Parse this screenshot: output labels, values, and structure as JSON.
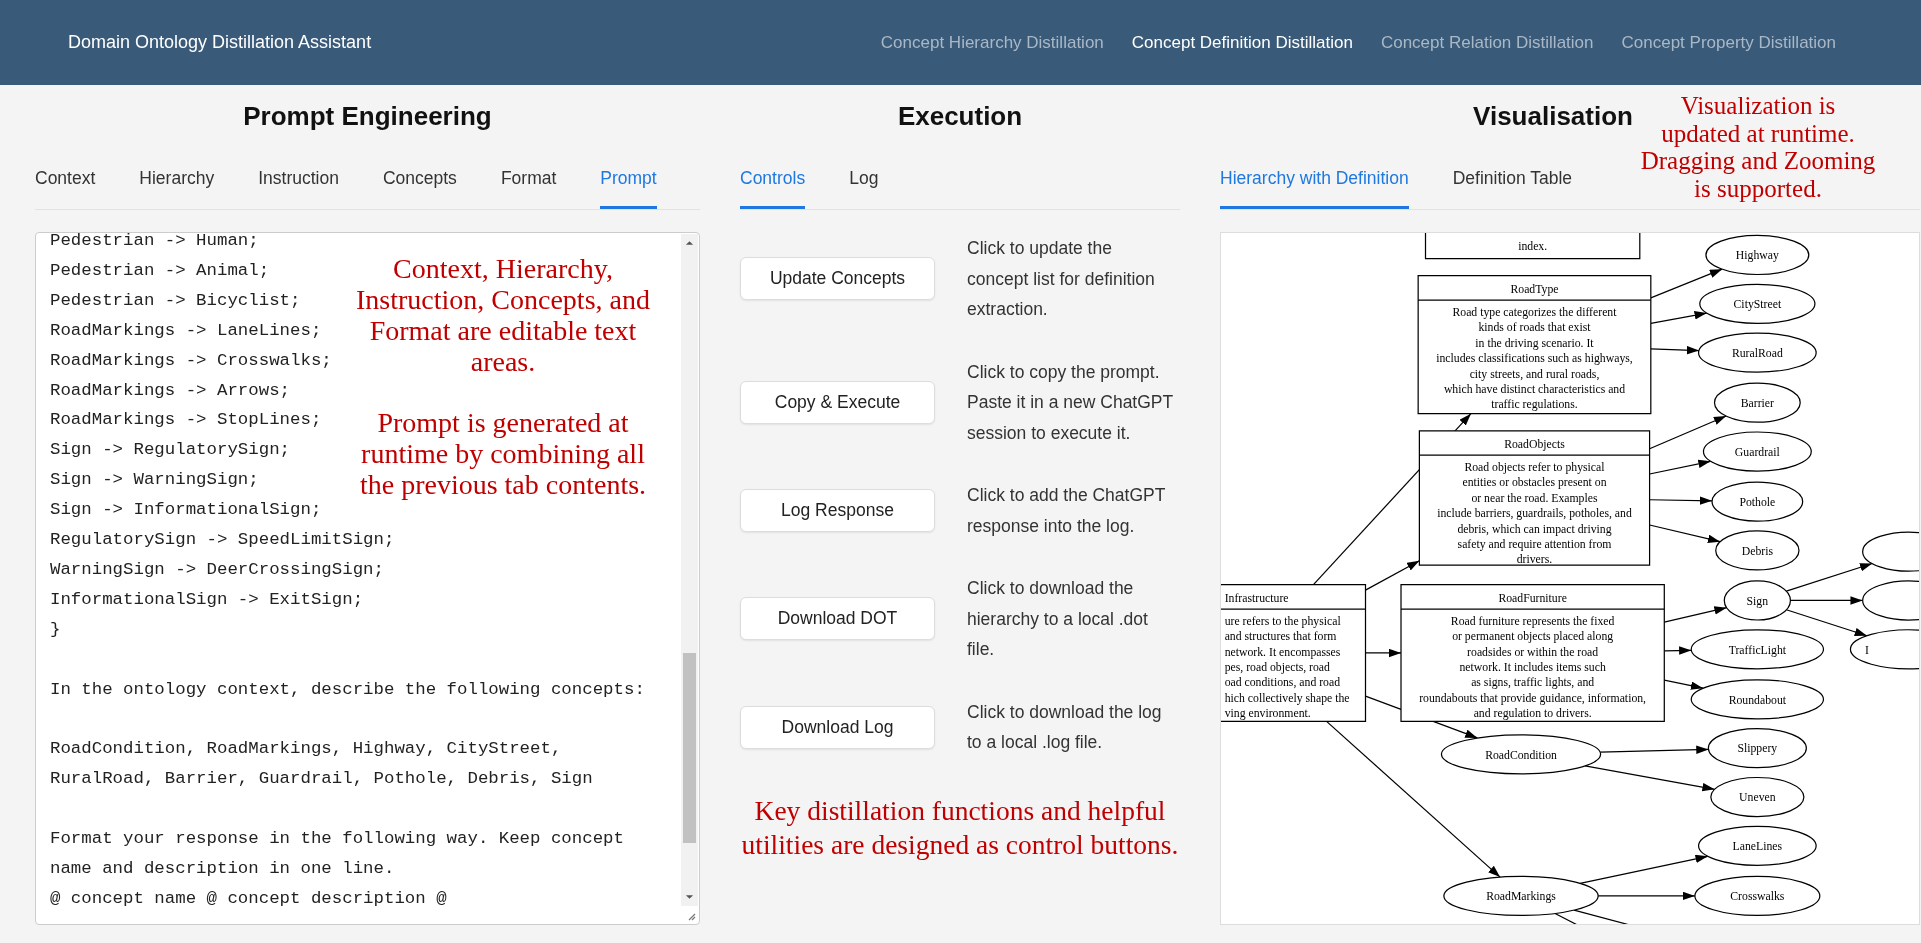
{
  "header": {
    "title": "Domain Ontology Distillation Assistant",
    "nav": [
      {
        "label": "Concept Hierarchy Distillation",
        "selected": false
      },
      {
        "label": "Concept Definition Distillation",
        "selected": true
      },
      {
        "label": "Concept Relation Distillation",
        "selected": false
      },
      {
        "label": "Concept Property Distillation",
        "selected": false
      }
    ]
  },
  "prompt_engineering": {
    "heading": "Prompt Engineering",
    "tabs": [
      {
        "label": "Context",
        "selected": false
      },
      {
        "label": "Hierarchy",
        "selected": false
      },
      {
        "label": "Instruction",
        "selected": false
      },
      {
        "label": "Concepts",
        "selected": false
      },
      {
        "label": "Format",
        "selected": false
      },
      {
        "label": "Prompt",
        "selected": true
      }
    ],
    "prompt_blocks": [
      [
        "Pedestrian -> Human;",
        "Pedestrian -> Animal;",
        "Pedestrian -> Bicyclist;",
        "RoadMarkings -> LaneLines;",
        "RoadMarkings -> Crosswalks;",
        "RoadMarkings -> Arrows;",
        "RoadMarkings -> StopLines;",
        "Sign -> RegulatorySign;",
        "Sign -> WarningSign;",
        "Sign -> InformationalSign;",
        "RegulatorySign -> SpeedLimitSign;",
        "WarningSign -> DeerCrossingSign;",
        "InformationalSign -> ExitSign;",
        "}"
      ],
      [
        "In the ontology context, describe the following concepts:"
      ],
      [
        "RoadCondition, RoadMarkings, Highway, CityStreet,",
        "RuralRoad, Barrier, Guardrail, Pothole, Debris, Sign"
      ],
      [
        "Format your response in the following way. Keep concept",
        "name and description in one line.",
        "@ concept name @ concept description @"
      ]
    ],
    "notes": [
      "Context, Hierarchy, Instruction, Concepts, and Format are editable text areas.",
      "Prompt is generated at runtime by combining all the previous tab contents."
    ]
  },
  "execution": {
    "heading": "Execution",
    "tabs": [
      {
        "label": "Controls",
        "selected": true
      },
      {
        "label": "Log",
        "selected": false
      }
    ],
    "controls": [
      {
        "button": "Update Concepts",
        "description": "Click to update the concept list for definition extraction."
      },
      {
        "button": "Copy & Execute",
        "description": "Click to copy the prompt. Paste it in a new ChatGPT session to execute it."
      },
      {
        "button": "Log Response",
        "description": "Click to add the ChatGPT response into the log."
      },
      {
        "button": "Download DOT",
        "description": "Click to download the hierarchy to a local .dot file."
      },
      {
        "button": "Download Log",
        "description": "Click to download the log to a local .log file."
      }
    ],
    "note": "Key distillation functions and helpful utilities are designed as control buttons."
  },
  "visualisation": {
    "heading": "Visualisation",
    "note": "Visualization is updated at runtime. Dragging and Zooming is supported.",
    "tabs": [
      {
        "label": "Hierarchy with Definition",
        "selected": true
      },
      {
        "label": "Definition Table",
        "selected": false
      }
    ],
    "graph": [
      {
        "kind": "record_cut_top",
        "lines": [
          "index."
        ]
      },
      {
        "kind": "record_cut_left",
        "label": "Infrastructure",
        "lines": [
          "ure refers to the physical",
          "and structures that form",
          "network. It encompasses",
          "pes, road objects, road",
          "oad conditions, and road",
          "hich collectively shape the",
          "ving environment."
        ],
        "children": [
          {
            "kind": "record",
            "label": "RoadType",
            "lines": [
              "Road type categorizes the different",
              "kinds of roads that exist",
              "in the driving scenario. It",
              "includes classifications such as highways,",
              "city streets, and rural roads,",
              "which have distinct characteristics and",
              "traffic regulations."
            ],
            "children": [
              {
                "kind": "ellipse",
                "label": "Highway"
              },
              {
                "kind": "ellipse",
                "label": "CityStreet"
              },
              {
                "kind": "ellipse",
                "label": "RuralRoad"
              }
            ]
          },
          {
            "kind": "record",
            "label": "RoadObjects",
            "lines": [
              "Road objects refer to physical",
              "entities or obstacles present on",
              "or near the road. Examples",
              "include barriers, guardrails, potholes, and",
              "debris, which can impact driving",
              "safety and require attention from",
              "drivers."
            ],
            "children": [
              {
                "kind": "ellipse",
                "label": "Barrier"
              },
              {
                "kind": "ellipse",
                "label": "Guardrail"
              },
              {
                "kind": "ellipse",
                "label": "Pothole"
              },
              {
                "kind": "ellipse",
                "label": "Debris"
              }
            ]
          },
          {
            "kind": "record",
            "label": "RoadFurniture",
            "lines": [
              "Road furniture represents the fixed",
              "or permanent objects placed along",
              "roadsides or within the road",
              "network. It includes items such",
              "as signs, traffic lights, and",
              "roundabouts that provide guidance, information,",
              "and regulation to drivers."
            ],
            "children": [
              {
                "kind": "ellipse",
                "label": "Sign",
                "children": [
                  {
                    "kind": "ellipse_cut"
                  },
                  {
                    "kind": "ellipse_cut"
                  },
                  {
                    "kind": "ellipse_cut",
                    "label": "I"
                  }
                ]
              },
              {
                "kind": "ellipse",
                "label": "TrafficLight"
              },
              {
                "kind": "ellipse",
                "label": "Roundabout"
              }
            ]
          },
          {
            "kind": "ellipse",
            "label": "RoadCondition",
            "children": [
              {
                "kind": "ellipse",
                "label": "Slippery"
              },
              {
                "kind": "ellipse",
                "label": "Uneven"
              }
            ]
          },
          {
            "kind": "ellipse",
            "label": "RoadMarkings",
            "children": [
              {
                "kind": "ellipse",
                "label": "LaneLines"
              },
              {
                "kind": "ellipse",
                "label": "Crosswalks"
              },
              {
                "kind": "offscreen"
              },
              {
                "kind": "offscreen"
              }
            ]
          }
        ]
      }
    ]
  }
}
